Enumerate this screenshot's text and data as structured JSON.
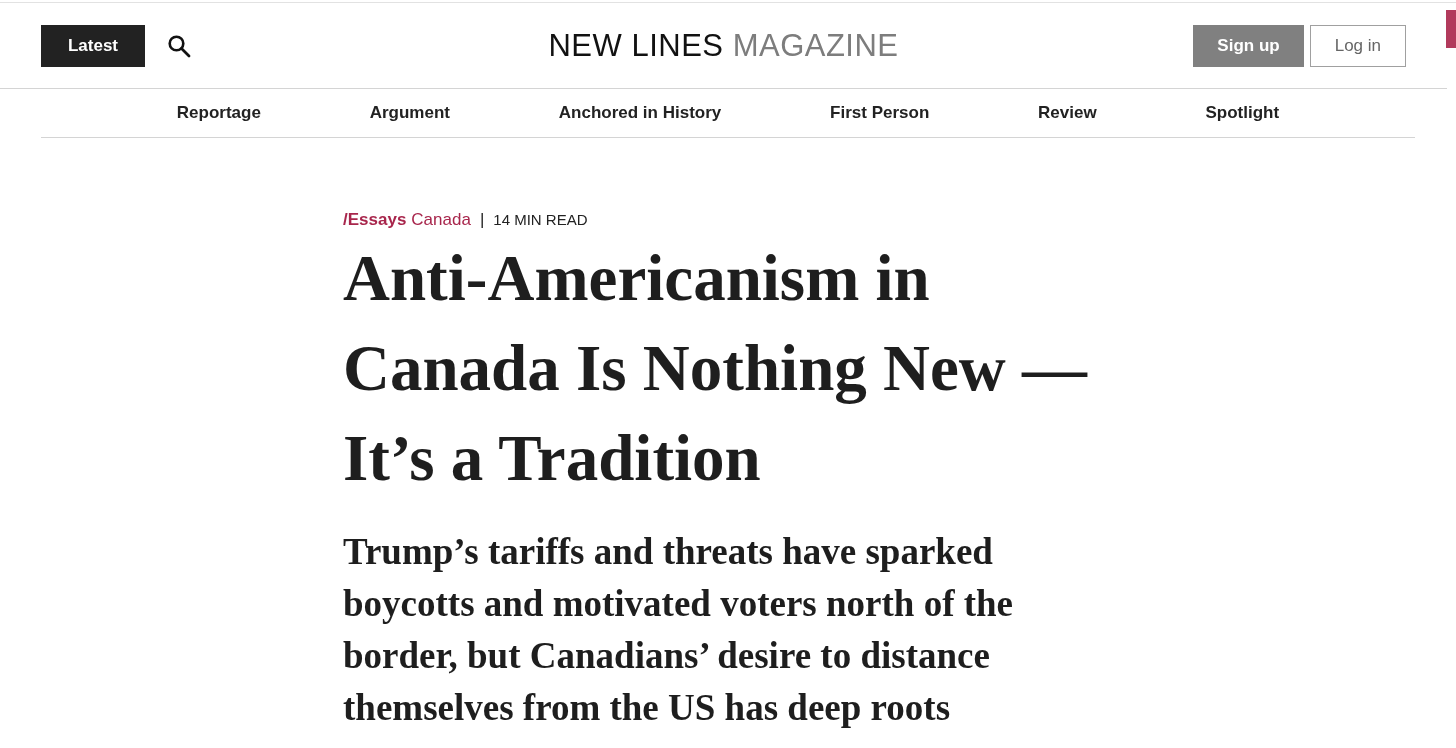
{
  "header": {
    "latest_button": "Latest",
    "logo": {
      "primary": "NEW LINES",
      "secondary": "MAGAZINE"
    },
    "buttons": [
      {
        "label": "Sign up",
        "kind": "filled"
      },
      {
        "label": "Log in",
        "kind": "outline"
      }
    ]
  },
  "nav": {
    "items": [
      "Reportage",
      "Argument",
      "Anchored in History",
      "First Person",
      "Review",
      "Spotlight"
    ]
  },
  "article": {
    "kicker": {
      "section": "/Essays",
      "topic": "Canada",
      "separator": "|",
      "read_time": "14 MIN READ"
    },
    "title": "Anti-Americanism in Canada Is Nothing New — It’s a Tradition",
    "dek": "Trump’s tariffs and threats have sparked boycotts and motivated voters north of the border, but Canadians’ desire to distance themselves from the US has deep roots"
  }
}
